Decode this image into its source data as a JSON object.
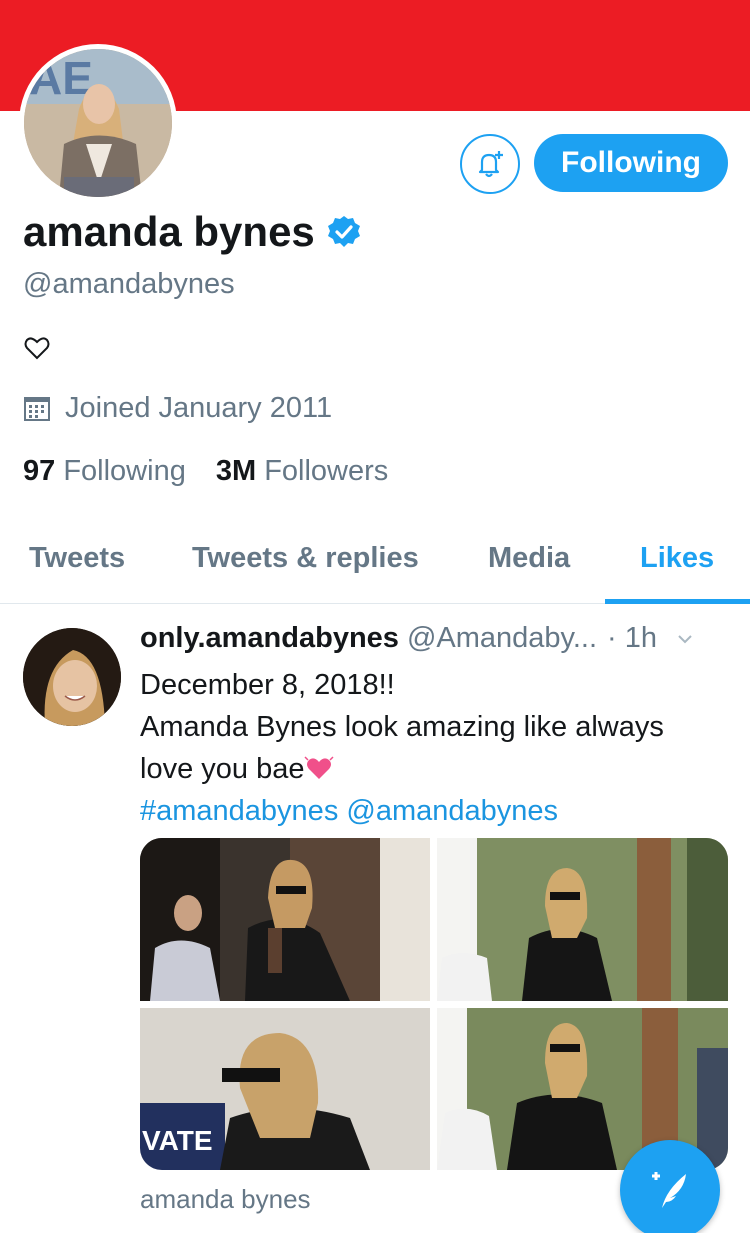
{
  "colors": {
    "banner": "#ec1c24",
    "accent": "#1da1f2",
    "secondary_text": "#657786",
    "primary_text": "#14171a",
    "link": "#1b95e0"
  },
  "profile": {
    "display_name": "amanda bynes",
    "handle": "@amandabynes",
    "verified": true,
    "banner_logo_text": "AE",
    "joined": "Joined January 2011",
    "following_count": "97",
    "following_label": "Following",
    "followers_count": "3M",
    "followers_label": "Followers",
    "icons": {
      "bio": "heart-icon",
      "joined": "calendar-icon",
      "notifications": "bell-plus-icon"
    }
  },
  "actions": {
    "follow_button_label": "Following"
  },
  "tabs": [
    {
      "label": "Tweets",
      "active": false
    },
    {
      "label": "Tweets & replies",
      "active": false
    },
    {
      "label": "Media",
      "active": false
    },
    {
      "label": "Likes",
      "active": true
    }
  ],
  "tweet": {
    "name": "only.amandabynes",
    "handle": "@Amandaby...",
    "time": "· 1h",
    "lines": [
      "December 8, 2018!!",
      "Amanda Bynes look amazing like always",
      "love you bae"
    ],
    "emoji": "heart-emoji",
    "hashtag": "#amandabynes",
    "mention": "@amandabynes",
    "media_count": 4,
    "footer": "amanda bynes"
  },
  "fab": {
    "icon": "compose-tweet-icon"
  }
}
